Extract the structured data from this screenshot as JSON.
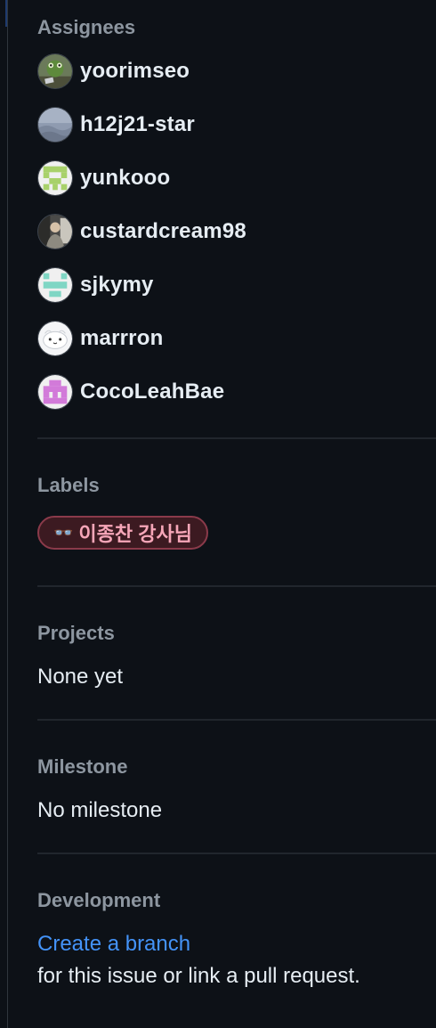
{
  "assignees": {
    "heading": "Assignees",
    "users": [
      {
        "name": "yoorimseo",
        "avatar": "frog-photo-avatar"
      },
      {
        "name": "h12j21-star",
        "avatar": "sky-photo-avatar"
      },
      {
        "name": "yunkooo",
        "avatar": "green-identicon-avatar"
      },
      {
        "name": "custardcream98",
        "avatar": "person-photo-avatar"
      },
      {
        "name": "sjkymy",
        "avatar": "teal-identicon-avatar"
      },
      {
        "name": "marrron",
        "avatar": "cartoon-face-avatar"
      },
      {
        "name": "CocoLeahBae",
        "avatar": "pink-identicon-avatar"
      }
    ]
  },
  "labels": {
    "heading": "Labels",
    "items": [
      {
        "emoji": "👓",
        "text": "이종찬 강사님",
        "bg": "#3c1a21",
        "border": "#8a3a4a",
        "color": "#f6a6b8"
      }
    ]
  },
  "projects": {
    "heading": "Projects",
    "value": "None yet"
  },
  "milestone": {
    "heading": "Milestone",
    "value": "No milestone"
  },
  "development": {
    "heading": "Development",
    "link_text": "Create a branch",
    "suffix_text": "for this issue or link a pull request."
  },
  "colors": {
    "background": "#0d1117",
    "heading": "#8d96a0",
    "text": "#e6edf3",
    "link": "#4493f8",
    "divider": "#21262d"
  }
}
